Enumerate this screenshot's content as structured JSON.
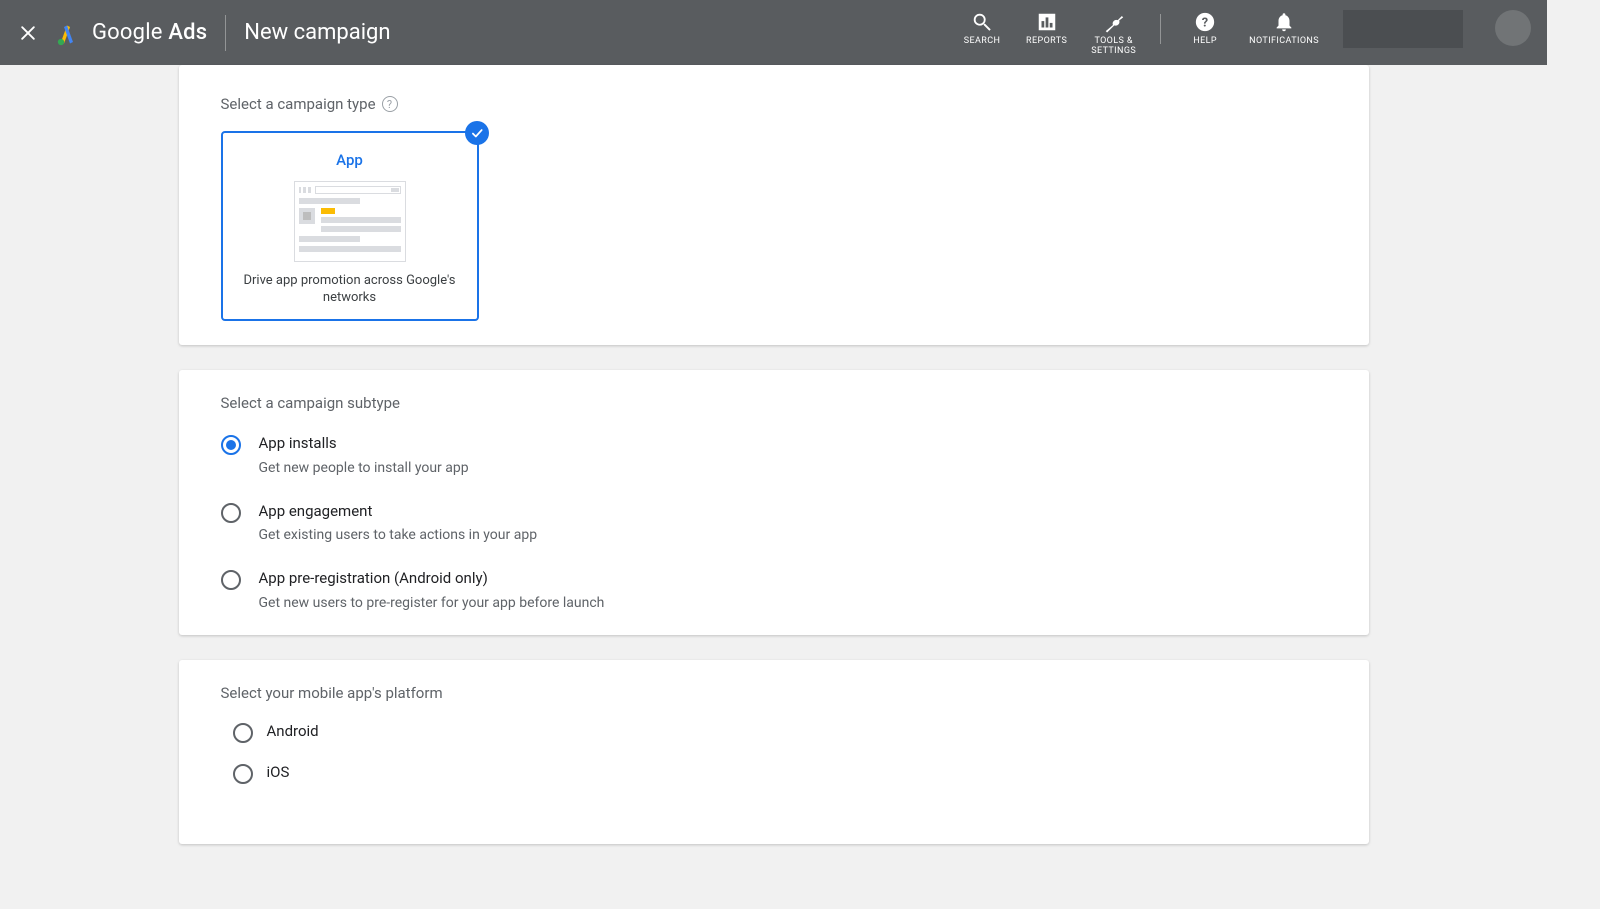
{
  "header": {
    "brand_prefix": "Google",
    "brand_suffix": "Ads",
    "page_title": "New campaign",
    "tools": {
      "search": "SEARCH",
      "reports": "REPORTS",
      "settings_line1": "TOOLS &",
      "settings_line2": "SETTINGS",
      "help": "HELP",
      "notifications": "NOTIFICATIONS"
    }
  },
  "campaign_type": {
    "section_label": "Select a campaign type",
    "card_title": "App",
    "card_desc": "Drive app promotion across Google's networks"
  },
  "subtype": {
    "section_label": "Select a campaign subtype",
    "options": [
      {
        "label": "App installs",
        "sub": "Get new people to install your app",
        "selected": true
      },
      {
        "label": "App engagement",
        "sub": "Get existing users to take actions in your app",
        "selected": false
      },
      {
        "label": "App pre-registration (Android only)",
        "sub": "Get new users to pre-register for your app before launch",
        "selected": false
      }
    ]
  },
  "platform": {
    "section_label": "Select your mobile app's platform",
    "options": [
      {
        "label": "Android",
        "selected": false
      },
      {
        "label": "iOS",
        "selected": false
      }
    ]
  }
}
